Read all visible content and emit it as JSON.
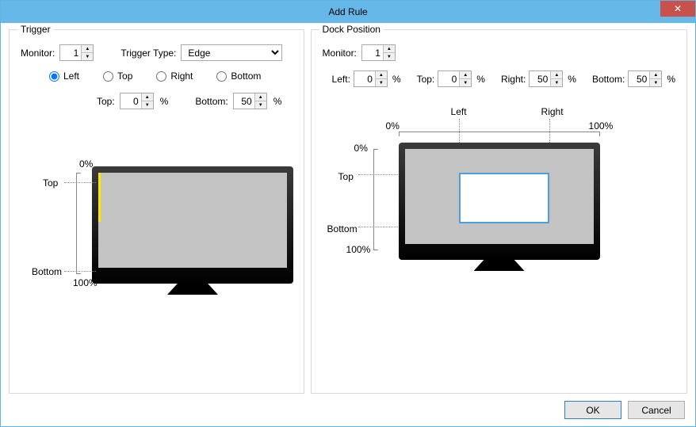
{
  "title": "Add Rule",
  "trigger": {
    "group_label": "Trigger",
    "monitor_label": "Monitor:",
    "monitor_value": "1",
    "type_label": "Trigger Type:",
    "type_value": "Edge",
    "radio_left": "Left",
    "radio_top": "Top",
    "radio_right": "Right",
    "radio_bottom": "Bottom",
    "pct_top_label": "Top:",
    "pct_top_value": "0",
    "pct_bottom_label": "Bottom:",
    "pct_bottom_value": "50",
    "pct_unit": "%",
    "diagram_top": "Top",
    "diagram_bottom": "Bottom",
    "diagram_0": "0%",
    "diagram_100": "100%"
  },
  "dock": {
    "group_label": "Dock Position",
    "monitor_label": "Monitor:",
    "monitor_value": "1",
    "left_label": "Left:",
    "left_value": "0",
    "top_label": "Top:",
    "top_value": "0",
    "right_label": "Right:",
    "right_value": "50",
    "bottom_label": "Bottom:",
    "bottom_value": "50",
    "pct_unit": "%",
    "diagram_left": "Left",
    "diagram_right": "Right",
    "diagram_top": "Top",
    "diagram_bottom": "Bottom",
    "diagram_0": "0%",
    "diagram_100": "100%"
  },
  "buttons": {
    "ok": "OK",
    "cancel": "Cancel"
  }
}
